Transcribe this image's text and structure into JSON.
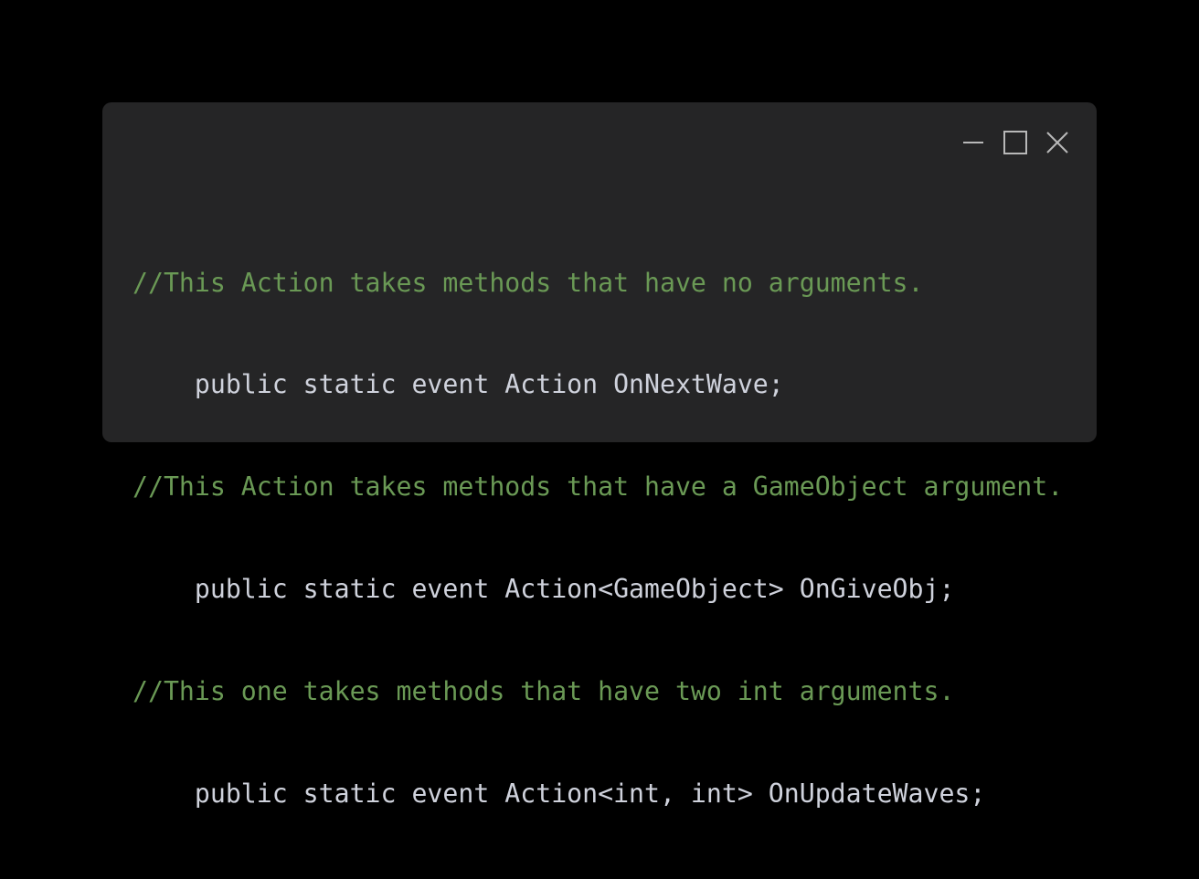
{
  "window": {
    "controls": {
      "minimize_icon": "minimize-icon",
      "maximize_icon": "maximize-icon",
      "close_icon": "close-icon"
    }
  },
  "code": {
    "lines": [
      {
        "kind": "comment",
        "text": "//This Action takes methods that have no arguments."
      },
      {
        "kind": "code",
        "text": "    public static event Action OnNextWave;"
      },
      {
        "kind": "comment",
        "text": "//This Action takes methods that have a GameObject argument."
      },
      {
        "kind": "code",
        "text": "    public static event Action<GameObject> OnGiveObj;"
      },
      {
        "kind": "comment",
        "text": "//This one takes methods that have two int arguments."
      },
      {
        "kind": "code",
        "text": "    public static event Action<int, int> OnUpdateWaves;"
      }
    ]
  },
  "colors": {
    "background": "#000000",
    "window": "#252526",
    "comment": "#6a9955",
    "code": "#cfd2dc",
    "icon": "#b8b8b8"
  }
}
